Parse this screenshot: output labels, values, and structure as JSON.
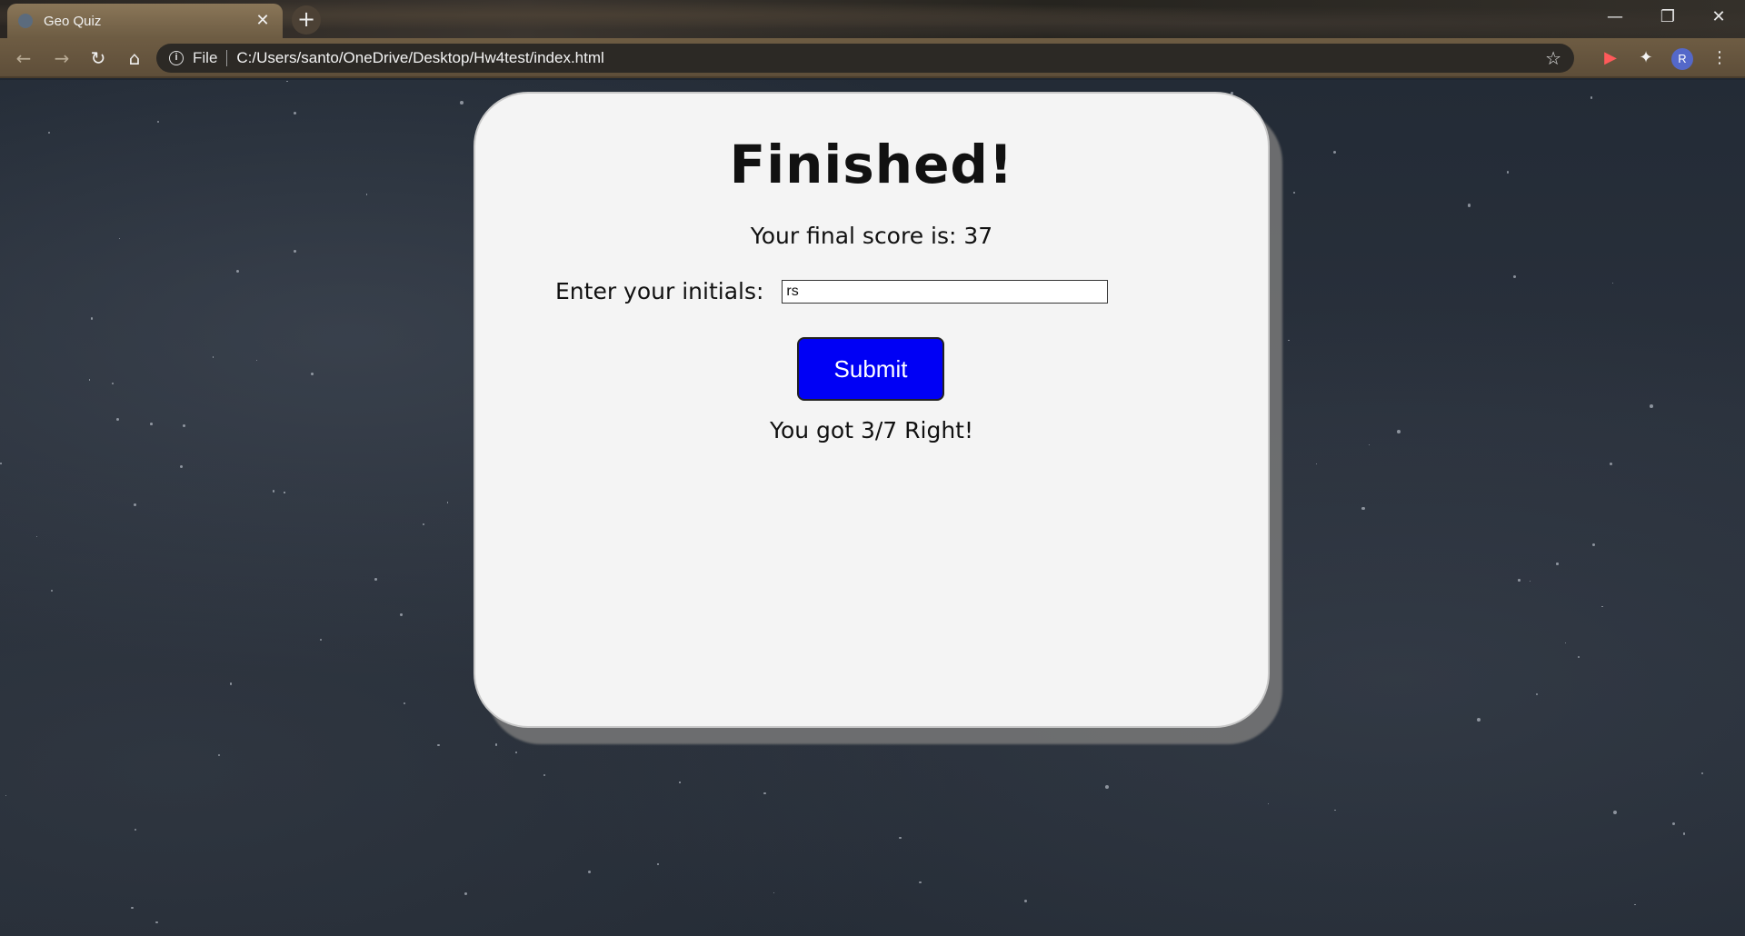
{
  "browser": {
    "tab_title": "Geo Quiz",
    "tab_close": "✕",
    "new_tab": "+",
    "url_scheme": "File",
    "url": "C:/Users/santo/OneDrive/Desktop/Hw4test/index.html",
    "profile_initial": "R",
    "accent_color": "#6e5c43"
  },
  "quiz": {
    "title": "Finished!",
    "score_text": "Your final score is: 37",
    "initials_label": "Enter your initials:",
    "initials_value": "rs",
    "submit_label": "Submit",
    "result_text": "You got 3/7 Right!",
    "submit_color": "#0000f5"
  }
}
